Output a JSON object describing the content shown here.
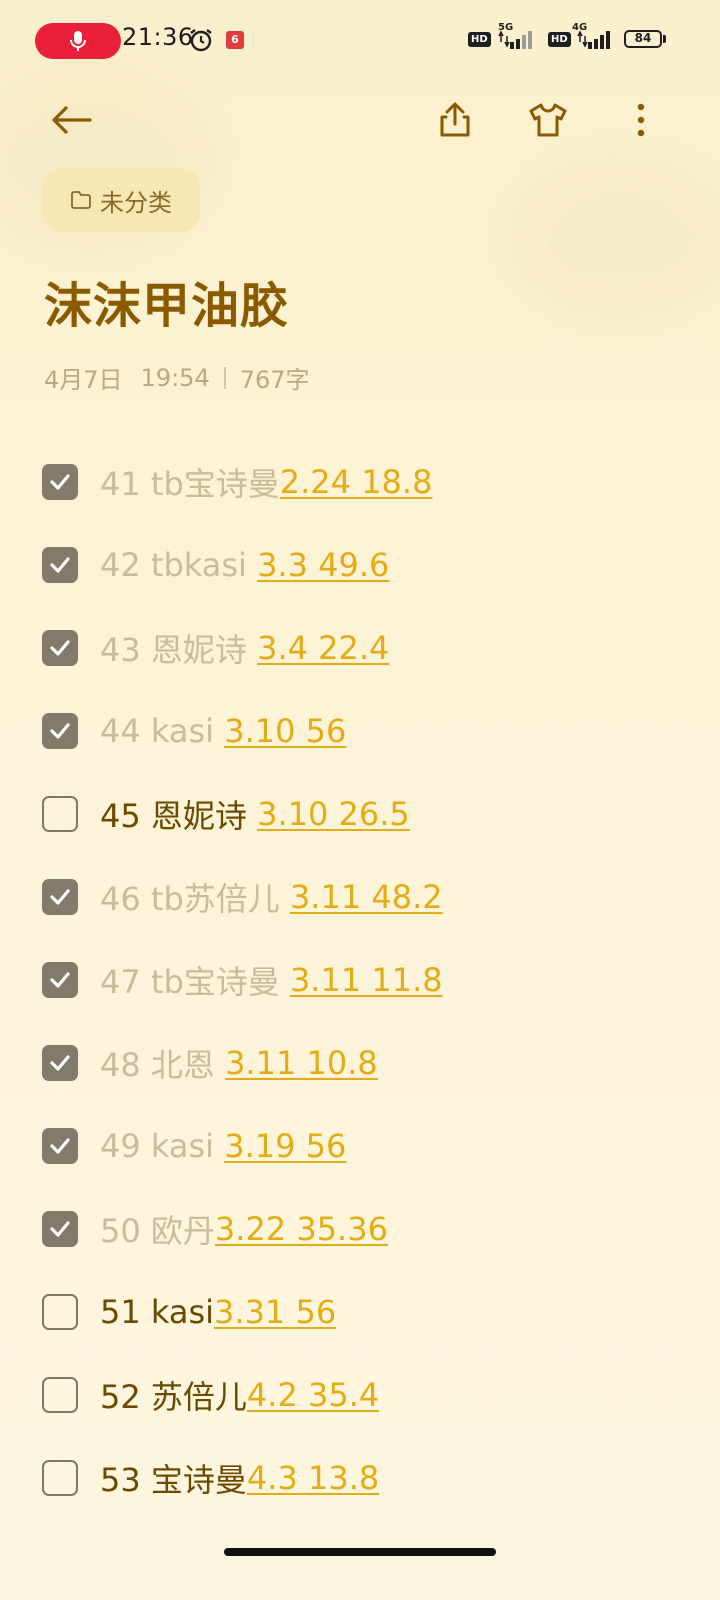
{
  "status_bar": {
    "time": "21:36",
    "battery": "84",
    "hd1": "HD",
    "net1": "5G",
    "hd2": "HD",
    "net2": "4G"
  },
  "toolbar": {
    "back_icon": "arrow-left-icon",
    "share_icon": "share-icon",
    "theme_icon": "shirt-icon",
    "more_icon": "more-vertical-icon"
  },
  "note": {
    "folder": "未分类",
    "title": "沫沫甲油胶",
    "date": "4月7日",
    "time": "19:54",
    "word_count": "767字"
  },
  "items": [
    {
      "checked": true,
      "text": "41 tb宝诗曼",
      "link": "2.24 18.8"
    },
    {
      "checked": true,
      "text": "42 tbkasi ",
      "link": "3.3 49.6"
    },
    {
      "checked": true,
      "text": "43 恩妮诗 ",
      "link": "3.4 22.4"
    },
    {
      "checked": true,
      "text": "44 kasi ",
      "link": "3.10 56"
    },
    {
      "checked": false,
      "text": "45 恩妮诗 ",
      "link": "3.10 26.5"
    },
    {
      "checked": true,
      "text": "46 tb苏倍儿 ",
      "link": "3.11 48.2"
    },
    {
      "checked": true,
      "text": "47 tb宝诗曼 ",
      "link": "3.11 11.8"
    },
    {
      "checked": true,
      "text": "48 北恩 ",
      "link": "3.11 10.8"
    },
    {
      "checked": true,
      "text": "49 kasi ",
      "link": "3.19 56"
    },
    {
      "checked": true,
      "text": "50 欧丹",
      "link": "3.22 35.36"
    },
    {
      "checked": false,
      "text": "51 kasi",
      "link": "3.31 56"
    },
    {
      "checked": false,
      "text": "52 苏倍儿",
      "link": "4.2 35.4"
    },
    {
      "checked": false,
      "text": "53 宝诗曼",
      "link": "4.3 13.8"
    }
  ],
  "colors": {
    "accent_link": "#e4ac14",
    "title": "#8a5a00",
    "background": "#fcf3d6"
  }
}
